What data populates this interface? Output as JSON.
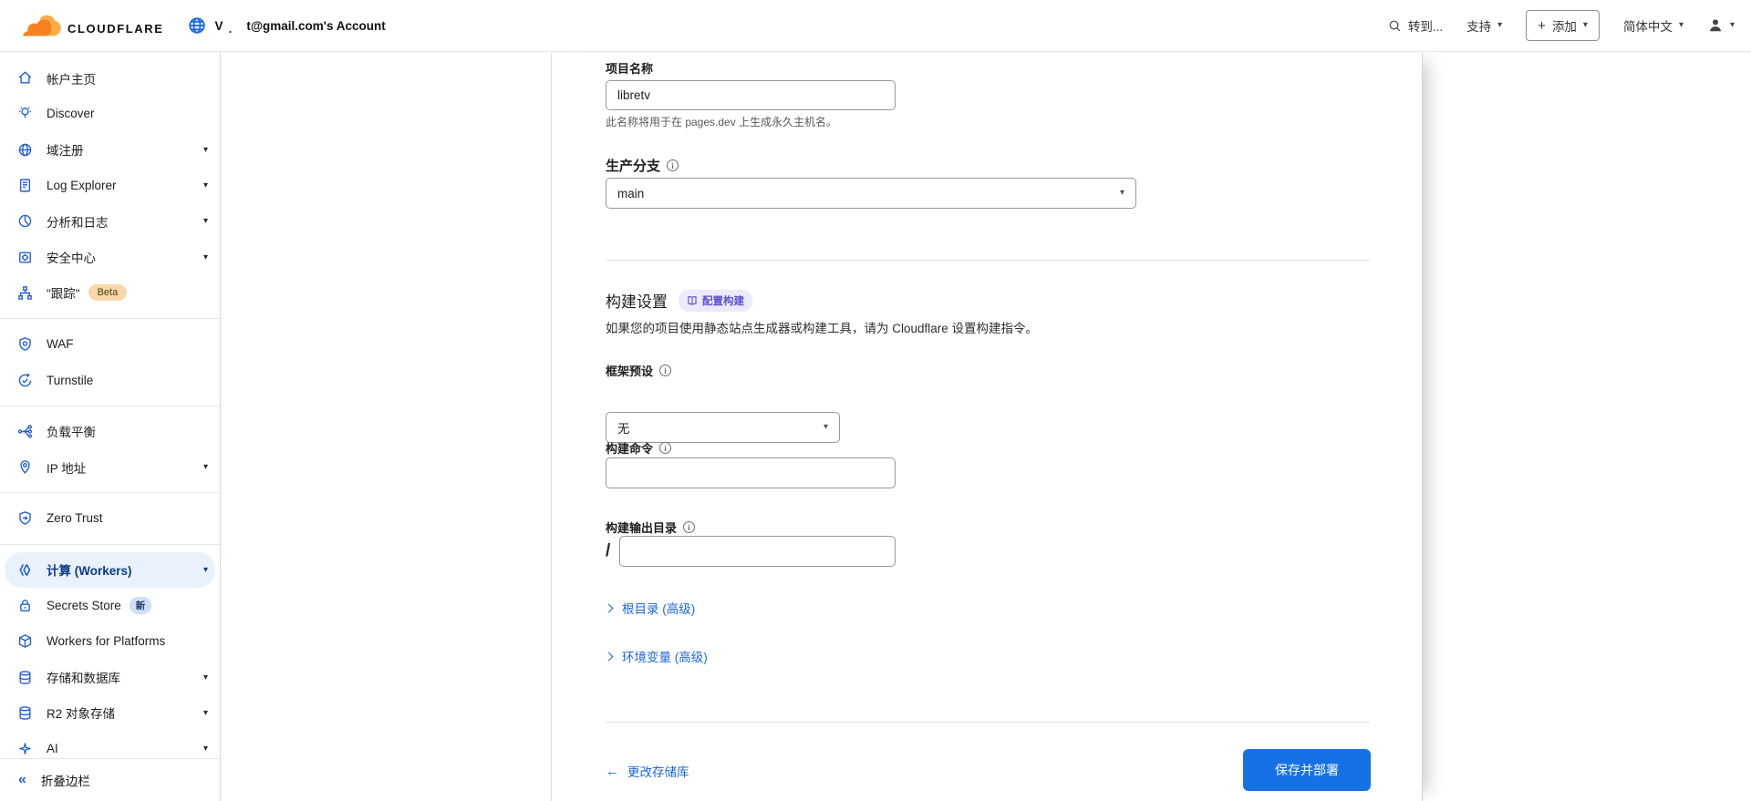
{
  "header": {
    "logo_text": "CLOUDFLARE",
    "account": {
      "prefix": "V",
      "dot": ".",
      "name": "t@gmail.com's Account"
    },
    "search_label": "转到...",
    "support_label": "支持",
    "add_plus": "+",
    "add_label": "添加",
    "language_label": "简体中文"
  },
  "sidebar": {
    "items": [
      {
        "icon": "home-icon",
        "label": "帐户主页"
      },
      {
        "icon": "lightbulb-icon",
        "label": "Discover"
      },
      {
        "icon": "globe-icon",
        "label": "域注册",
        "chevron": true
      },
      {
        "icon": "log-icon",
        "label": "Log Explorer",
        "chevron": true
      },
      {
        "icon": "analytics-icon",
        "label": "分析和日志",
        "chevron": true
      },
      {
        "icon": "security-icon",
        "label": "安全中心",
        "chevron": true
      },
      {
        "icon": "trace-icon",
        "label": "\"跟踪\"",
        "badge": "Beta",
        "badge_type": "beta"
      },
      {
        "icon": "waf-icon",
        "label": "WAF",
        "divider_before": true
      },
      {
        "icon": "turnstile-icon",
        "label": "Turnstile"
      },
      {
        "icon": "load-balancer-icon",
        "label": "负载平衡",
        "divider_before": true
      },
      {
        "icon": "ip-icon",
        "label": "IP 地址",
        "chevron": true
      },
      {
        "icon": "zero-trust-icon",
        "label": "Zero Trust",
        "divider_before": true
      },
      {
        "icon": "workers-icon",
        "label": "计算 (Workers)",
        "chevron": true,
        "selected": true,
        "divider_before": true
      },
      {
        "icon": "lock-icon",
        "label": "Secrets Store",
        "badge": "新",
        "badge_type": "new"
      },
      {
        "icon": "platforms-icon",
        "label": "Workers for Platforms"
      },
      {
        "icon": "storage-icon",
        "label": "存储和数据库",
        "chevron": true
      },
      {
        "icon": "r2-icon",
        "label": "R2 对象存储",
        "chevron": true
      },
      {
        "icon": "ai-icon",
        "label": "AI",
        "chevron": true
      }
    ],
    "collapse_label": "折叠边栏"
  },
  "main": {
    "project_name": {
      "label": "项目名称",
      "value": "libretv",
      "helper": "此名称将用于在 pages.dev 上生成永久主机名。"
    },
    "production_branch": {
      "label": "生产分支",
      "value": "main"
    },
    "build_settings": {
      "title": "构建设置",
      "badge": "配置构建",
      "description": "如果您的项目使用静态站点生成器或构建工具，请为 Cloudflare 设置构建指令。"
    },
    "framework_preset": {
      "label": "框架预设",
      "value": "无"
    },
    "build_command": {
      "label": "构建命令",
      "value": ""
    },
    "build_output": {
      "label": "构建输出目录",
      "prefix": "/",
      "value": ""
    },
    "advanced_links": {
      "root_dir": "根目录 (高级)",
      "env_vars": "环境变量 (高级)"
    },
    "footer": {
      "back_link": "更改存储库",
      "save_button": "保存并部署"
    }
  },
  "colors": {
    "accent_blue": "#1671e6",
    "link_blue": "#1a66dd",
    "sidebar_icon_blue": "#2160d3",
    "selected_bg": "#e8f1fc",
    "selected_text": "#0b3a86",
    "logo_orange": "#f6821f",
    "logo_orange_light": "#fbad41",
    "badge_beta_bg": "#f8d8a8",
    "badge_new_bg": "#cfe0f5",
    "badge_build_bg": "#eceafc",
    "badge_build_text": "#5f51d4"
  }
}
